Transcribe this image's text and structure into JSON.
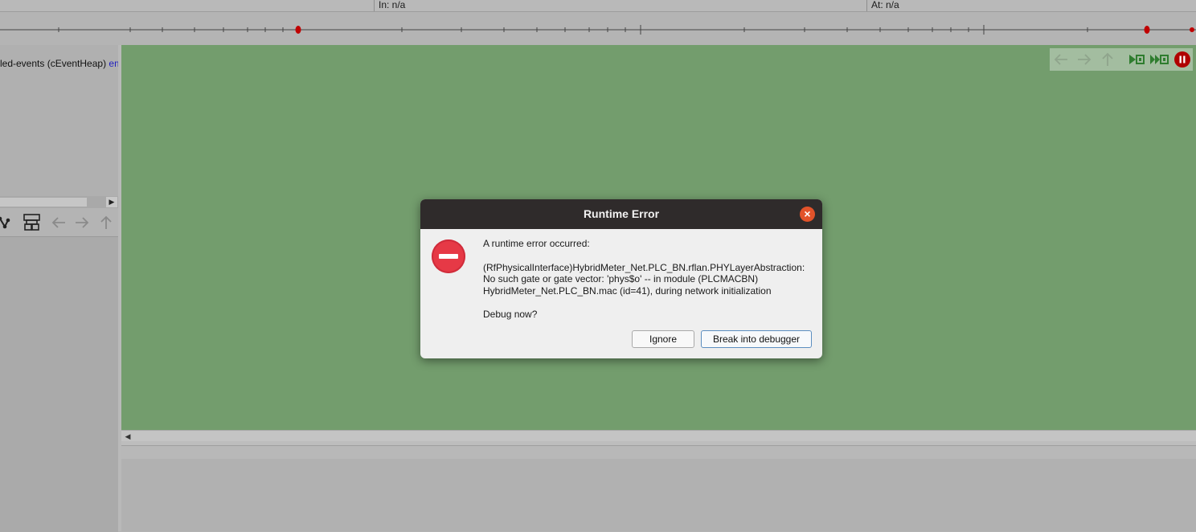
{
  "status_bar": {
    "in_label": "In: n/a",
    "at_label": "At: n/a"
  },
  "object_tree": {
    "event_text": "led-events (cEventHeap)",
    "event_link": "em"
  },
  "dialog": {
    "title": "Runtime Error",
    "header": "A runtime error occurred:",
    "message_line1": "(RfPhysicalInterface)HybridMeter_Net.PLC_BN.rflan.PHYLayerAbstraction:",
    "message_line2": "No such gate or gate vector: 'phys$o' -- in module (PLCMACBN)",
    "message_line3": "HybridMeter_Net.PLC_BN.mac (id=41), during network initialization",
    "question": "Debug now?",
    "ignore_label": "Ignore",
    "break_label": "Break into debugger"
  },
  "icons": {
    "close": "close-icon",
    "error": "error-icon",
    "back": "arrow-left-icon",
    "forward": "arrow-right-icon",
    "up": "arrow-up-icon",
    "step": "step-icon",
    "run": "fast-run-icon",
    "stop": "stop-icon",
    "layout": "layout-icon",
    "graph": "graph-icon"
  },
  "colors": {
    "canvas": "#739d6d",
    "dialog_title": "#2f2b2b",
    "error_red": "#e63946",
    "close_orange": "#e2532a",
    "timeline_marker": "#c00000"
  }
}
